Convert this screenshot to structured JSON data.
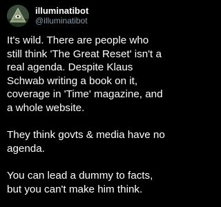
{
  "user": {
    "display_name": "illuminatibot",
    "handle": "@illuminatibot",
    "avatar_icon": "illuminati-pyramid-eye-icon"
  },
  "tweet": {
    "paragraphs": [
      "It's wild. There are people who\nstill think 'The Great Reset' isn't a\nreal agenda. Despite Klaus\nSchwab writing a book on it,\ncoverage in 'Time' magazine, and\na whole website.",
      "They think govts & media have no\nagenda.",
      "You can lead a dummy to facts,\nbut you can't make him think."
    ]
  },
  "colors": {
    "background": "#000000",
    "text": "#ffffff",
    "handle": "#8b98a5"
  }
}
